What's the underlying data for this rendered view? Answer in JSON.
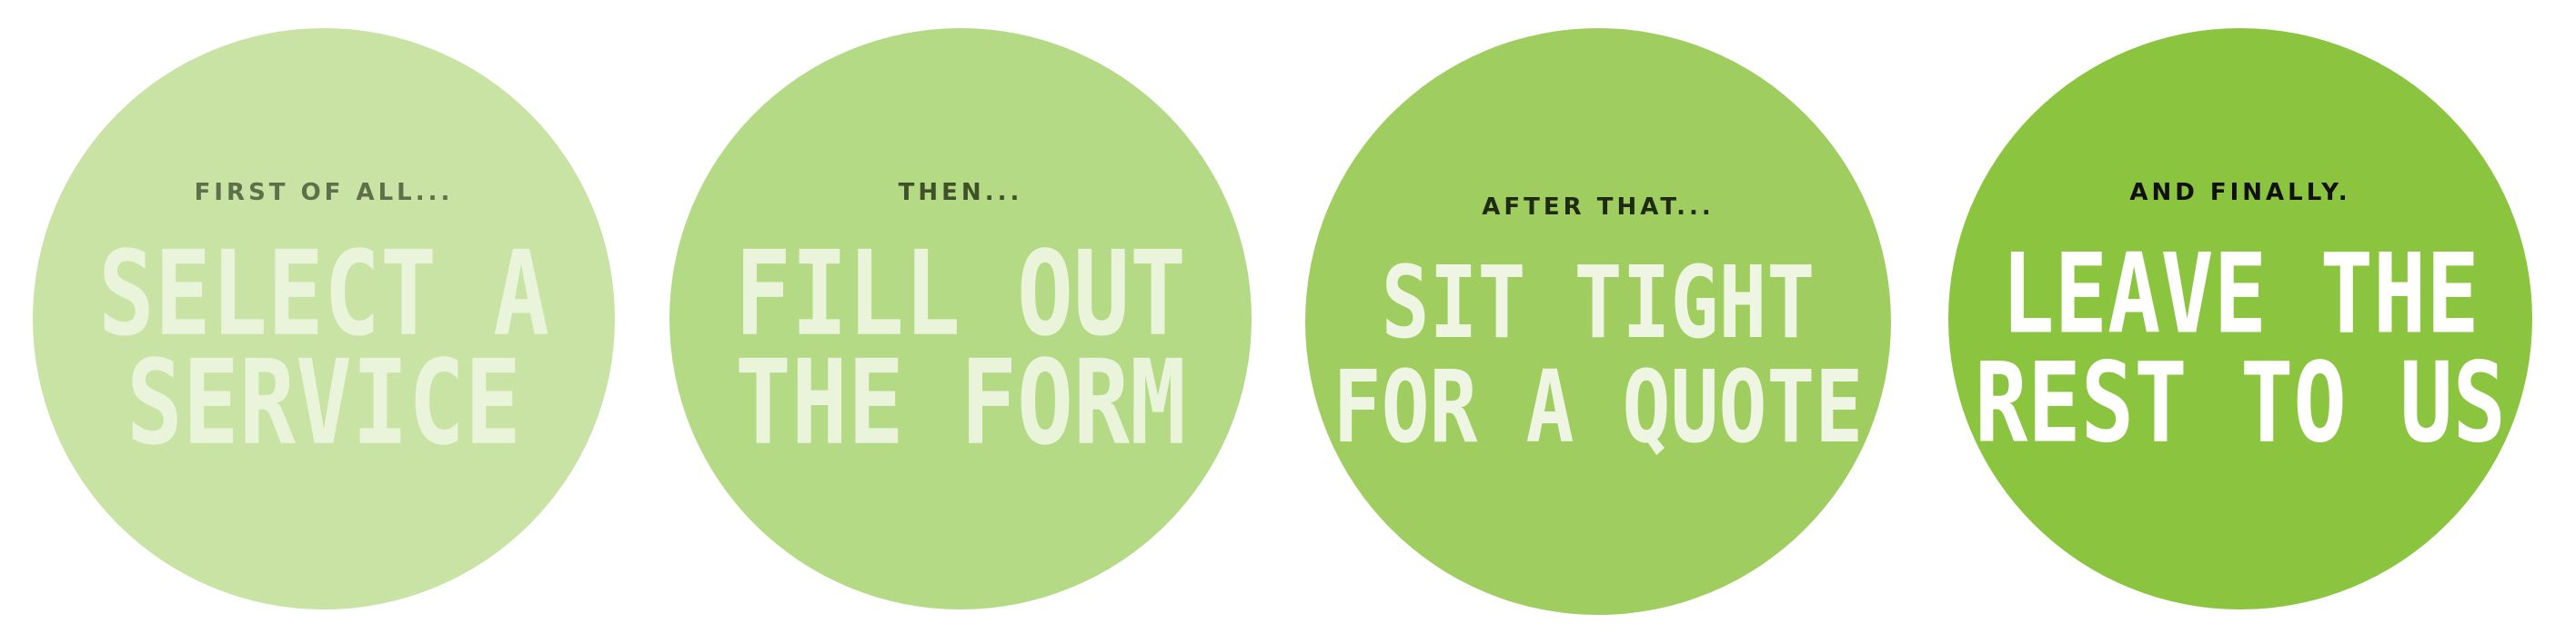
{
  "steps": [
    {
      "kicker": "FIRST OF ALL...",
      "lines": [
        "SELECT A",
        "SERVICE"
      ],
      "circle_color": "#c8e3a3"
    },
    {
      "kicker": "THEN...",
      "lines": [
        "FILL OUT",
        "THE FORM"
      ],
      "circle_color": "#b4da85"
    },
    {
      "kicker": "AFTER THAT...",
      "lines": [
        "SIT TIGHT",
        "FOR A QUOTE"
      ],
      "circle_color": "#a0cd5f"
    },
    {
      "kicker": "AND FINALLY.",
      "lines": [
        "LEAVE THE",
        "REST TO US"
      ],
      "circle_color": "#8bc43f"
    }
  ]
}
